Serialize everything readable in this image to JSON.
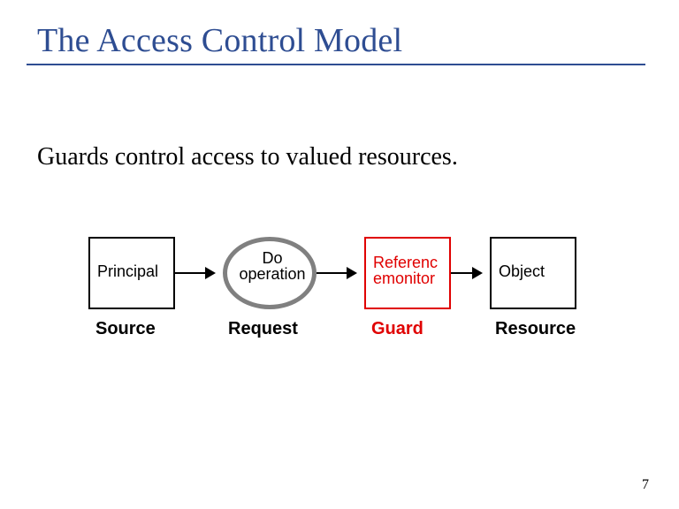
{
  "title": "The Access Control Model",
  "subtitle": "Guards control access to valued resources.",
  "nodes": {
    "principal": "Principal",
    "operation": "Do operation",
    "monitor": "Referencemonitor",
    "object": "Object"
  },
  "labels": {
    "source": "Source",
    "request": "Request",
    "guard": "Guard",
    "resource": "Resource"
  },
  "page_number": "7"
}
